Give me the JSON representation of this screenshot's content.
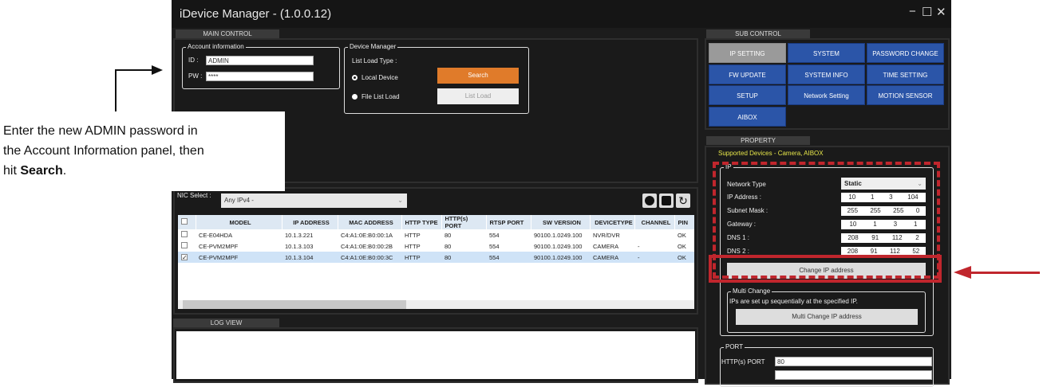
{
  "window": {
    "title": "iDevice Manager - (1.0.0.12)",
    "min": "−",
    "max": "☐",
    "close": "✕"
  },
  "main_control": {
    "tab": "MAIN CONTROL",
    "account": {
      "legend": "Account information",
      "id_label": "ID :",
      "id_value": "ADMIN",
      "pw_label": "PW :",
      "pw_value": "****"
    },
    "device_manager": {
      "legend": "Device Manager",
      "list_load_type": "List Load Type :",
      "radio_local": "Local Device",
      "radio_file": "File List Load",
      "search": "Search",
      "list_load": "List Load"
    }
  },
  "nic": {
    "label": "NIC Select :",
    "value": "Any IPv4 -"
  },
  "table": {
    "headers": [
      "MODEL",
      "IP ADDRESS",
      "MAC ADDRESS",
      "HTTP TYPE",
      "HTTP(s) PORT",
      "RTSP PORT",
      "SW VERSION",
      "DEVICETYPE",
      "CHANNEL",
      "PIN"
    ],
    "rows": [
      {
        "checked": false,
        "cells": [
          "CE-E04HDA",
          "10.1.3.221",
          "C4:A1:0E:B0:00:1A",
          "HTTP",
          "80",
          "554",
          "90100.1.0249.100",
          "NVR/DVR",
          "",
          "OK"
        ]
      },
      {
        "checked": false,
        "cells": [
          "CE-PVM2MPF",
          "10.1.3.103",
          "C4:A1:0E:B0:00:2B",
          "HTTP",
          "80",
          "554",
          "90100.1.0249.100",
          "CAMERA",
          "-",
          "OK"
        ]
      },
      {
        "checked": true,
        "cells": [
          "CE-PVM2MPF",
          "10.1.3.104",
          "C4:A1:0E:B0:00:3C",
          "HTTP",
          "80",
          "554",
          "90100.1.0249.100",
          "CAMERA",
          "-",
          "OK"
        ]
      }
    ]
  },
  "log": {
    "tab": "LOG VIEW"
  },
  "sub_control": {
    "tab": "SUB CONTROL",
    "buttons": [
      "IP SETTING",
      "SYSTEM",
      "PASSWORD CHANGE",
      "FW UPDATE",
      "SYSTEM INFO",
      "TIME SETTING",
      "SETUP",
      "Network Setting",
      "MOTION SENSOR",
      "AIBOX"
    ]
  },
  "property": {
    "tab": "PROPERTY",
    "supported": "Supported Devices - Camera, AIBOX",
    "ip": {
      "legend": "IP",
      "network_type_label": "Network Type",
      "network_type": "Static",
      "rows": [
        {
          "label": "IP Address :",
          "v": [
            "10",
            "1",
            "3",
            "104"
          ]
        },
        {
          "label": "Subnet Mask :",
          "v": [
            "255",
            "255",
            "255",
            "0"
          ]
        },
        {
          "label": "Gateway :",
          "v": [
            "10",
            "1",
            "3",
            "1"
          ]
        },
        {
          "label": "DNS 1 :",
          "v": [
            "208",
            "91",
            "112",
            "2"
          ]
        },
        {
          "label": "DNS 2 :",
          "v": [
            "208",
            "91",
            "112",
            "52"
          ]
        }
      ],
      "change_button": "Change IP address"
    },
    "multi": {
      "legend": "Multi Change",
      "desc": "IPs are set up sequentially at the specified IP.",
      "button": "Multi Change IP address"
    },
    "port": {
      "legend": "PORT",
      "http_label": "HTTP(s) PORT",
      "http_value": "80"
    }
  },
  "annotation": {
    "line1": "Enter the new ADMIN password in",
    "line2": "the Account Information panel, then",
    "line3_pre": "hit ",
    "line3_bold": "Search",
    "line3_post": "."
  },
  "colors": {
    "accent_orange": "#e07b2a",
    "blue": "#2b55a8",
    "highlight_red": "#c0262d",
    "supported_yellow": "#e6e64a"
  }
}
